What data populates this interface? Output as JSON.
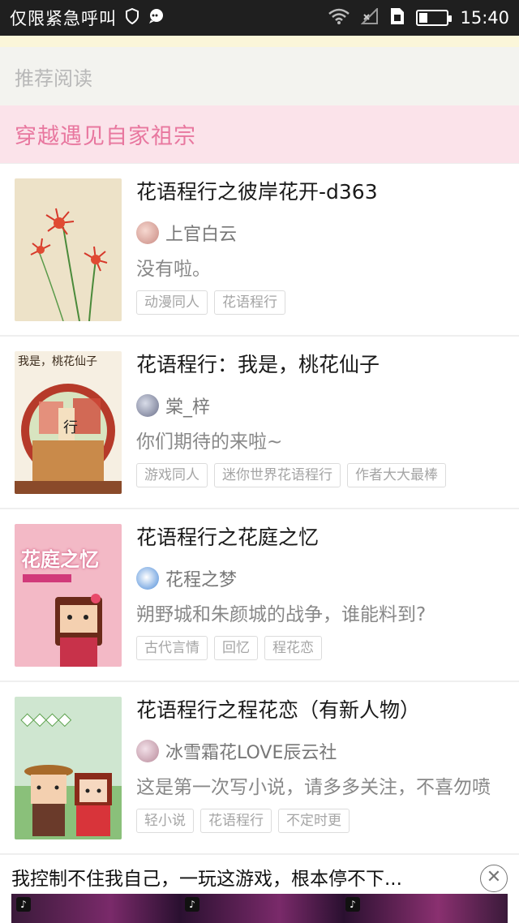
{
  "status_bar": {
    "carrier": "仅限紧急呼叫",
    "time": "15:40",
    "icons": [
      "shield-icon",
      "message-icon",
      "wifi-icon",
      "no-signal-icon",
      "sim-icon",
      "battery-icon"
    ],
    "battery_level": 0.3
  },
  "section": {
    "recommend_label": "推荐阅读",
    "category_title": "穿越遇见自家祖宗"
  },
  "books": [
    {
      "title": "花语程行之彼岸花开-d363",
      "author": "上官白云",
      "description": "没有啦。",
      "tags": [
        "动漫同人",
        "花语程行"
      ]
    },
    {
      "title": "花语程行：我是，桃花仙子",
      "author": "棠_梓",
      "description": "你们期待的来啦~",
      "tags": [
        "游戏同人",
        "迷你世界花语程行",
        "作者大大最棒"
      ],
      "cover_text": "我是，桃花仙子"
    },
    {
      "title": "花语程行之花庭之忆",
      "author": "花程之梦",
      "description": "朔野城和朱颜城的战争，谁能料到?",
      "tags": [
        "古代言情",
        "回忆",
        "程花恋"
      ],
      "cover_text": "花庭之忆"
    },
    {
      "title": "花语程行之程花恋（有新人物）",
      "author": "冰雪霜花LOVE辰云社",
      "description": "这是第一次写小说，请多多关注，不喜勿喷",
      "tags": [
        "轻小说",
        "花语程行",
        "不定时更"
      ]
    }
  ],
  "ad": {
    "text": "我控制不住我自己，一玩这游戏，根本停不下...",
    "close_icon": "close-icon"
  },
  "colors": {
    "accent_pink": "#e8779f",
    "pink_header_bg": "#fbe3ea"
  }
}
